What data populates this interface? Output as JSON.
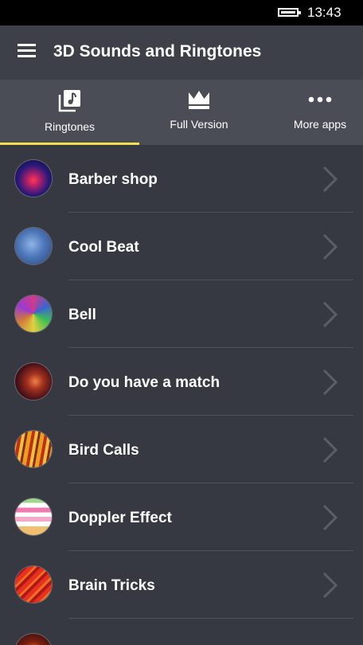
{
  "status_bar": {
    "time": "13:43",
    "battery_icon": "battery-full-icon"
  },
  "app_bar": {
    "menu_icon": "hamburger-menu-icon",
    "title": "3D Sounds and Ringtones"
  },
  "tabs": [
    {
      "label": "Ringtones",
      "icon": "music-library-icon",
      "selected": true
    },
    {
      "label": "Full Version",
      "icon": "crown-icon",
      "selected": false
    },
    {
      "label": "More apps",
      "icon": "more-dots-icon",
      "selected": false
    }
  ],
  "colors": {
    "accent": "#f1e24a",
    "background": "#363941",
    "tab_bar": "#4a4d56"
  },
  "ringtones": [
    {
      "label": "Barber shop"
    },
    {
      "label": "Cool Beat"
    },
    {
      "label": "Bell"
    },
    {
      "label": "Do you have a match"
    },
    {
      "label": "Bird Calls"
    },
    {
      "label": "Doppler Effect"
    },
    {
      "label": "Brain Tricks"
    }
  ]
}
